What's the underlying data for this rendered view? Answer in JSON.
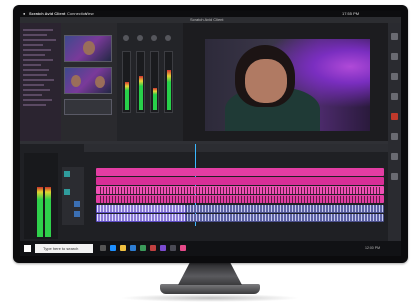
{
  "menubar": {
    "apple_icon": "apple-icon",
    "app_name": "Scratch Avid Client",
    "menus": [
      "Connection",
      "View"
    ],
    "clock": "17:55 PM"
  },
  "app": {
    "window_title": "Scratch Avid Client"
  },
  "timeline": {
    "clip_colors": [
      "#e33da3",
      "#5d4cc4",
      "#2f9c9c"
    ]
  },
  "taskbar": {
    "search_placeholder": "Type here to search",
    "clock": "12:00 PM"
  }
}
